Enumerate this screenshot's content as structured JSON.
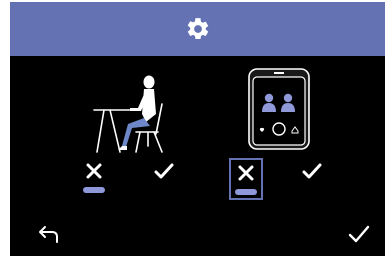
{
  "header": {
    "title_icon": "gear-icon",
    "background": "#6472b4"
  },
  "posture_setting": {
    "illustration": "person-seated-at-desk-icon",
    "options": [
      {
        "icon": "cross-icon",
        "selected": true,
        "indicator_color": "#8f98d8"
      },
      {
        "icon": "check-icon",
        "selected": false
      }
    ]
  },
  "device_setting": {
    "illustration": "device-screen-icon",
    "options": [
      {
        "icon": "cross-icon",
        "selected": true,
        "focused": true,
        "indicator_color": "#8f98d8"
      },
      {
        "icon": "check-icon",
        "selected": false
      }
    ]
  },
  "footer": {
    "back_icon": "back-arrow-icon",
    "confirm_icon": "check-icon"
  }
}
